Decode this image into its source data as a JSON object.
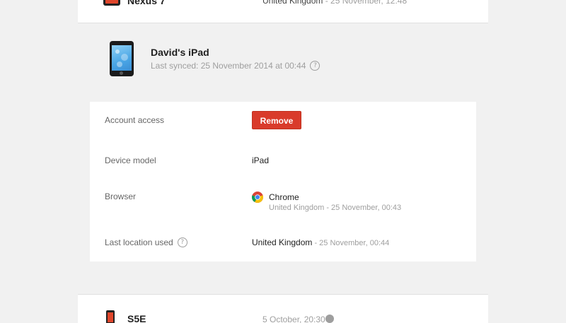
{
  "top_device": {
    "name": "Nexus 7",
    "location": "United Kingdom",
    "time": " - 25 November, 12:48"
  },
  "device": {
    "name": "David's iPad",
    "last_synced": "Last synced: 25 November 2014 at 00:44"
  },
  "details": {
    "account_access_label": "Account access",
    "remove_label": "Remove",
    "device_model_label": "Device model",
    "device_model_value": "iPad",
    "browser_label": "Browser",
    "browser_name": "Chrome",
    "browser_sub": "United Kingdom - 25 November, 00:43",
    "last_location_label": "Last location used",
    "last_location_value": "United Kingdom",
    "last_location_time": " - 25 November, 00:44"
  },
  "bottom_device": {
    "name": "S5E",
    "location": "5 October, 20:30"
  },
  "colors": {
    "accent_red": "#d93b2b",
    "background": "#f1f1f1"
  }
}
